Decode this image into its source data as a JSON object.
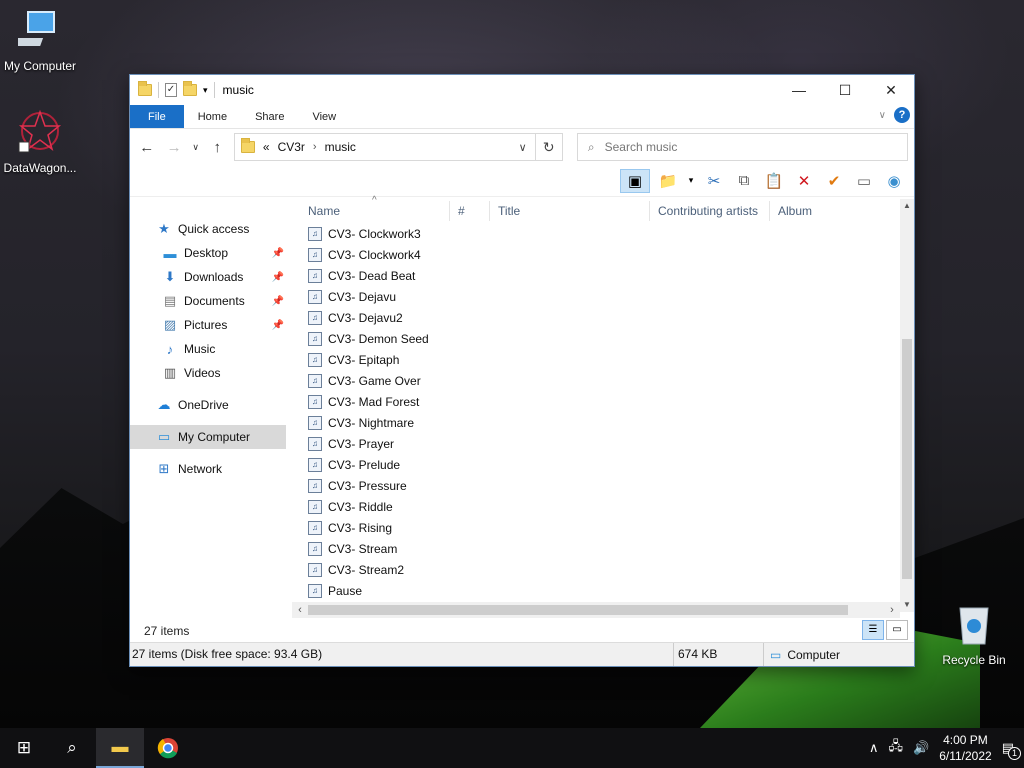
{
  "desktop": {
    "icons": [
      {
        "label": "My Computer"
      },
      {
        "label": "DataWagon..."
      },
      {
        "label": "Recycle Bin"
      }
    ]
  },
  "window": {
    "title": "music",
    "controls": {
      "minimize": "—",
      "maximize": "☐",
      "close": "✕"
    }
  },
  "ribbon": {
    "tabs": [
      "File",
      "Home",
      "Share",
      "View"
    ]
  },
  "address": {
    "prefix": "«",
    "crumbs": [
      "CV3r",
      "music"
    ],
    "search_placeholder": "Search music"
  },
  "nav": {
    "items": [
      {
        "label": "Quick access"
      },
      {
        "label": "Desktop"
      },
      {
        "label": "Downloads"
      },
      {
        "label": "Documents"
      },
      {
        "label": "Pictures"
      },
      {
        "label": "Music"
      },
      {
        "label": "Videos"
      },
      {
        "label": "OneDrive"
      },
      {
        "label": "My Computer"
      },
      {
        "label": "Network"
      }
    ]
  },
  "columns": [
    "Name",
    "#",
    "Title",
    "Contributing artists",
    "Album"
  ],
  "files": [
    "CV3- Clockwork3",
    "CV3- Clockwork4",
    "CV3- Dead Beat",
    "CV3- Dejavu",
    "CV3- Dejavu2",
    "CV3- Demon Seed",
    "CV3- Epitaph",
    "CV3- Game Over",
    "CV3- Mad Forest",
    "CV3- Nightmare",
    "CV3- Prayer",
    "CV3- Prelude",
    "CV3- Pressure",
    "CV3- Riddle",
    "CV3- Rising",
    "CV3- Stream",
    "CV3- Stream2",
    "Pause"
  ],
  "footer": {
    "item_count": "27 items"
  },
  "statusbar": {
    "summary": "27 items (Disk free space: 93.4 GB)",
    "size": "674 KB",
    "location": "Computer"
  },
  "taskbar": {
    "time": "4:00 PM",
    "date": "6/11/2022",
    "notification_count": "1"
  }
}
